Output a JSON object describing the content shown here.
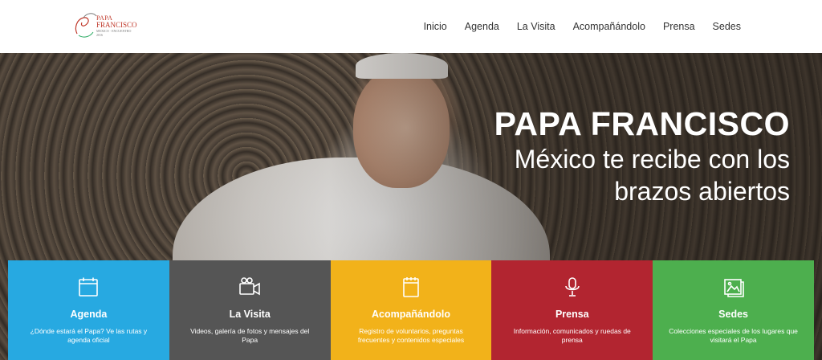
{
  "logo": {
    "line1": "PAPA",
    "line2": "FRANCISCO",
    "line3": "MEXICO · ENCUENTRO 2016"
  },
  "nav": [
    "Inicio",
    "Agenda",
    "La Visita",
    "Acompañándolo",
    "Prensa",
    "Sedes"
  ],
  "hero": {
    "title": "PAPA FRANCISCO",
    "subtitle_line1": "México te recibe con los",
    "subtitle_line2": "brazos abiertos"
  },
  "cards": [
    {
      "icon": "calendar-icon",
      "title": "Agenda",
      "desc": "¿Dónde estará el Papa? Ve las rutas y agenda oficial",
      "color": "#27a9e1"
    },
    {
      "icon": "video-camera-icon",
      "title": "La Visita",
      "desc": "Videos, galería de fotos y mensajes del Papa",
      "color": "#555555"
    },
    {
      "icon": "notepad-icon",
      "title": "Acompañándolo",
      "desc": "Registro de voluntarios, preguntas frecuentes y contenidos especiales",
      "color": "#f2b21a"
    },
    {
      "icon": "microphone-icon",
      "title": "Prensa",
      "desc": "Información, comunicados y ruedas de prensa",
      "color": "#b22530"
    },
    {
      "icon": "picture-icon",
      "title": "Sedes",
      "desc": "Colecciones especiales de los lugares que visitará el Papa",
      "color": "#4daf4e"
    }
  ]
}
